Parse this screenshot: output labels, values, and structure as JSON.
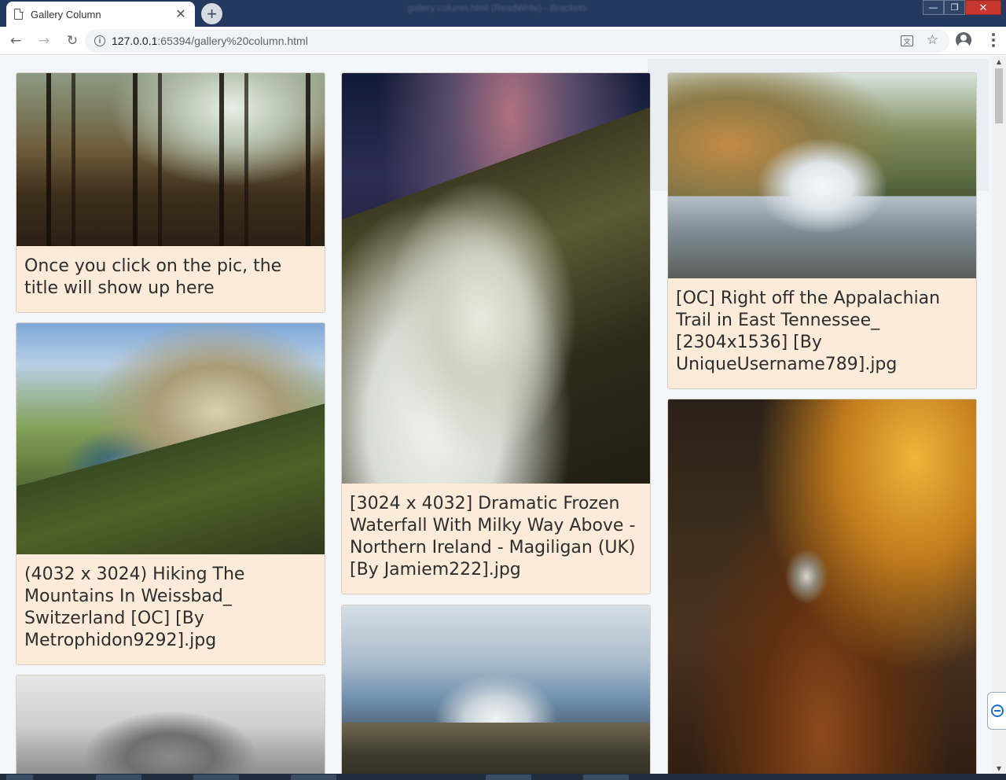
{
  "browser": {
    "tab_title": "Gallery Column",
    "tab_close_glyph": "✕",
    "new_tab_glyph": "+",
    "window_title": "gallery column.html (ReadWrite) - Brackets",
    "window_controls": [
      "—",
      "❐",
      "✕"
    ],
    "nav": {
      "back": "←",
      "forward": "→",
      "reload": "↻"
    },
    "url_host": "127.0.0.1",
    "url_rest": ":65394/gallery%20column.html",
    "icons": [
      "info-icon",
      "translate-icon",
      "star-icon",
      "account-icon",
      "menu-icon"
    ]
  },
  "gallery": {
    "columns": [
      {
        "cards": [
          {
            "image": "forest-photo",
            "caption": "Once you click on the pic, the title will show up here"
          },
          {
            "image": "mountain-photo",
            "caption": "(4032 x 3024) Hiking The Mountains In Weissbad_ Switzerland [OC] [By Metrophidon9292].jpg"
          },
          {
            "image": "snowy-hill-photo",
            "caption": ""
          }
        ]
      },
      {
        "cards": [
          {
            "image": "frozen-waterfall-photo",
            "caption": "[3024 x 4032] Dramatic Frozen Waterfall With Milky Way Above - Northern Ireland - Magiligan (UK) [By Jamiem222].jpg"
          },
          {
            "image": "valley-photo",
            "caption": ""
          }
        ]
      },
      {
        "cards": [
          {
            "image": "waterfall-photo",
            "caption": "[OC] Right off the Appalachian Trail in East Tennessee_ [2304x1536] [By UniqueUsername789].jpg"
          },
          {
            "image": "rock-arch-photo",
            "caption": ""
          }
        ]
      }
    ]
  },
  "colors": {
    "card_background": "#fbebd8",
    "page_background": "#f3f7fc",
    "titlebar": "#23395d"
  }
}
